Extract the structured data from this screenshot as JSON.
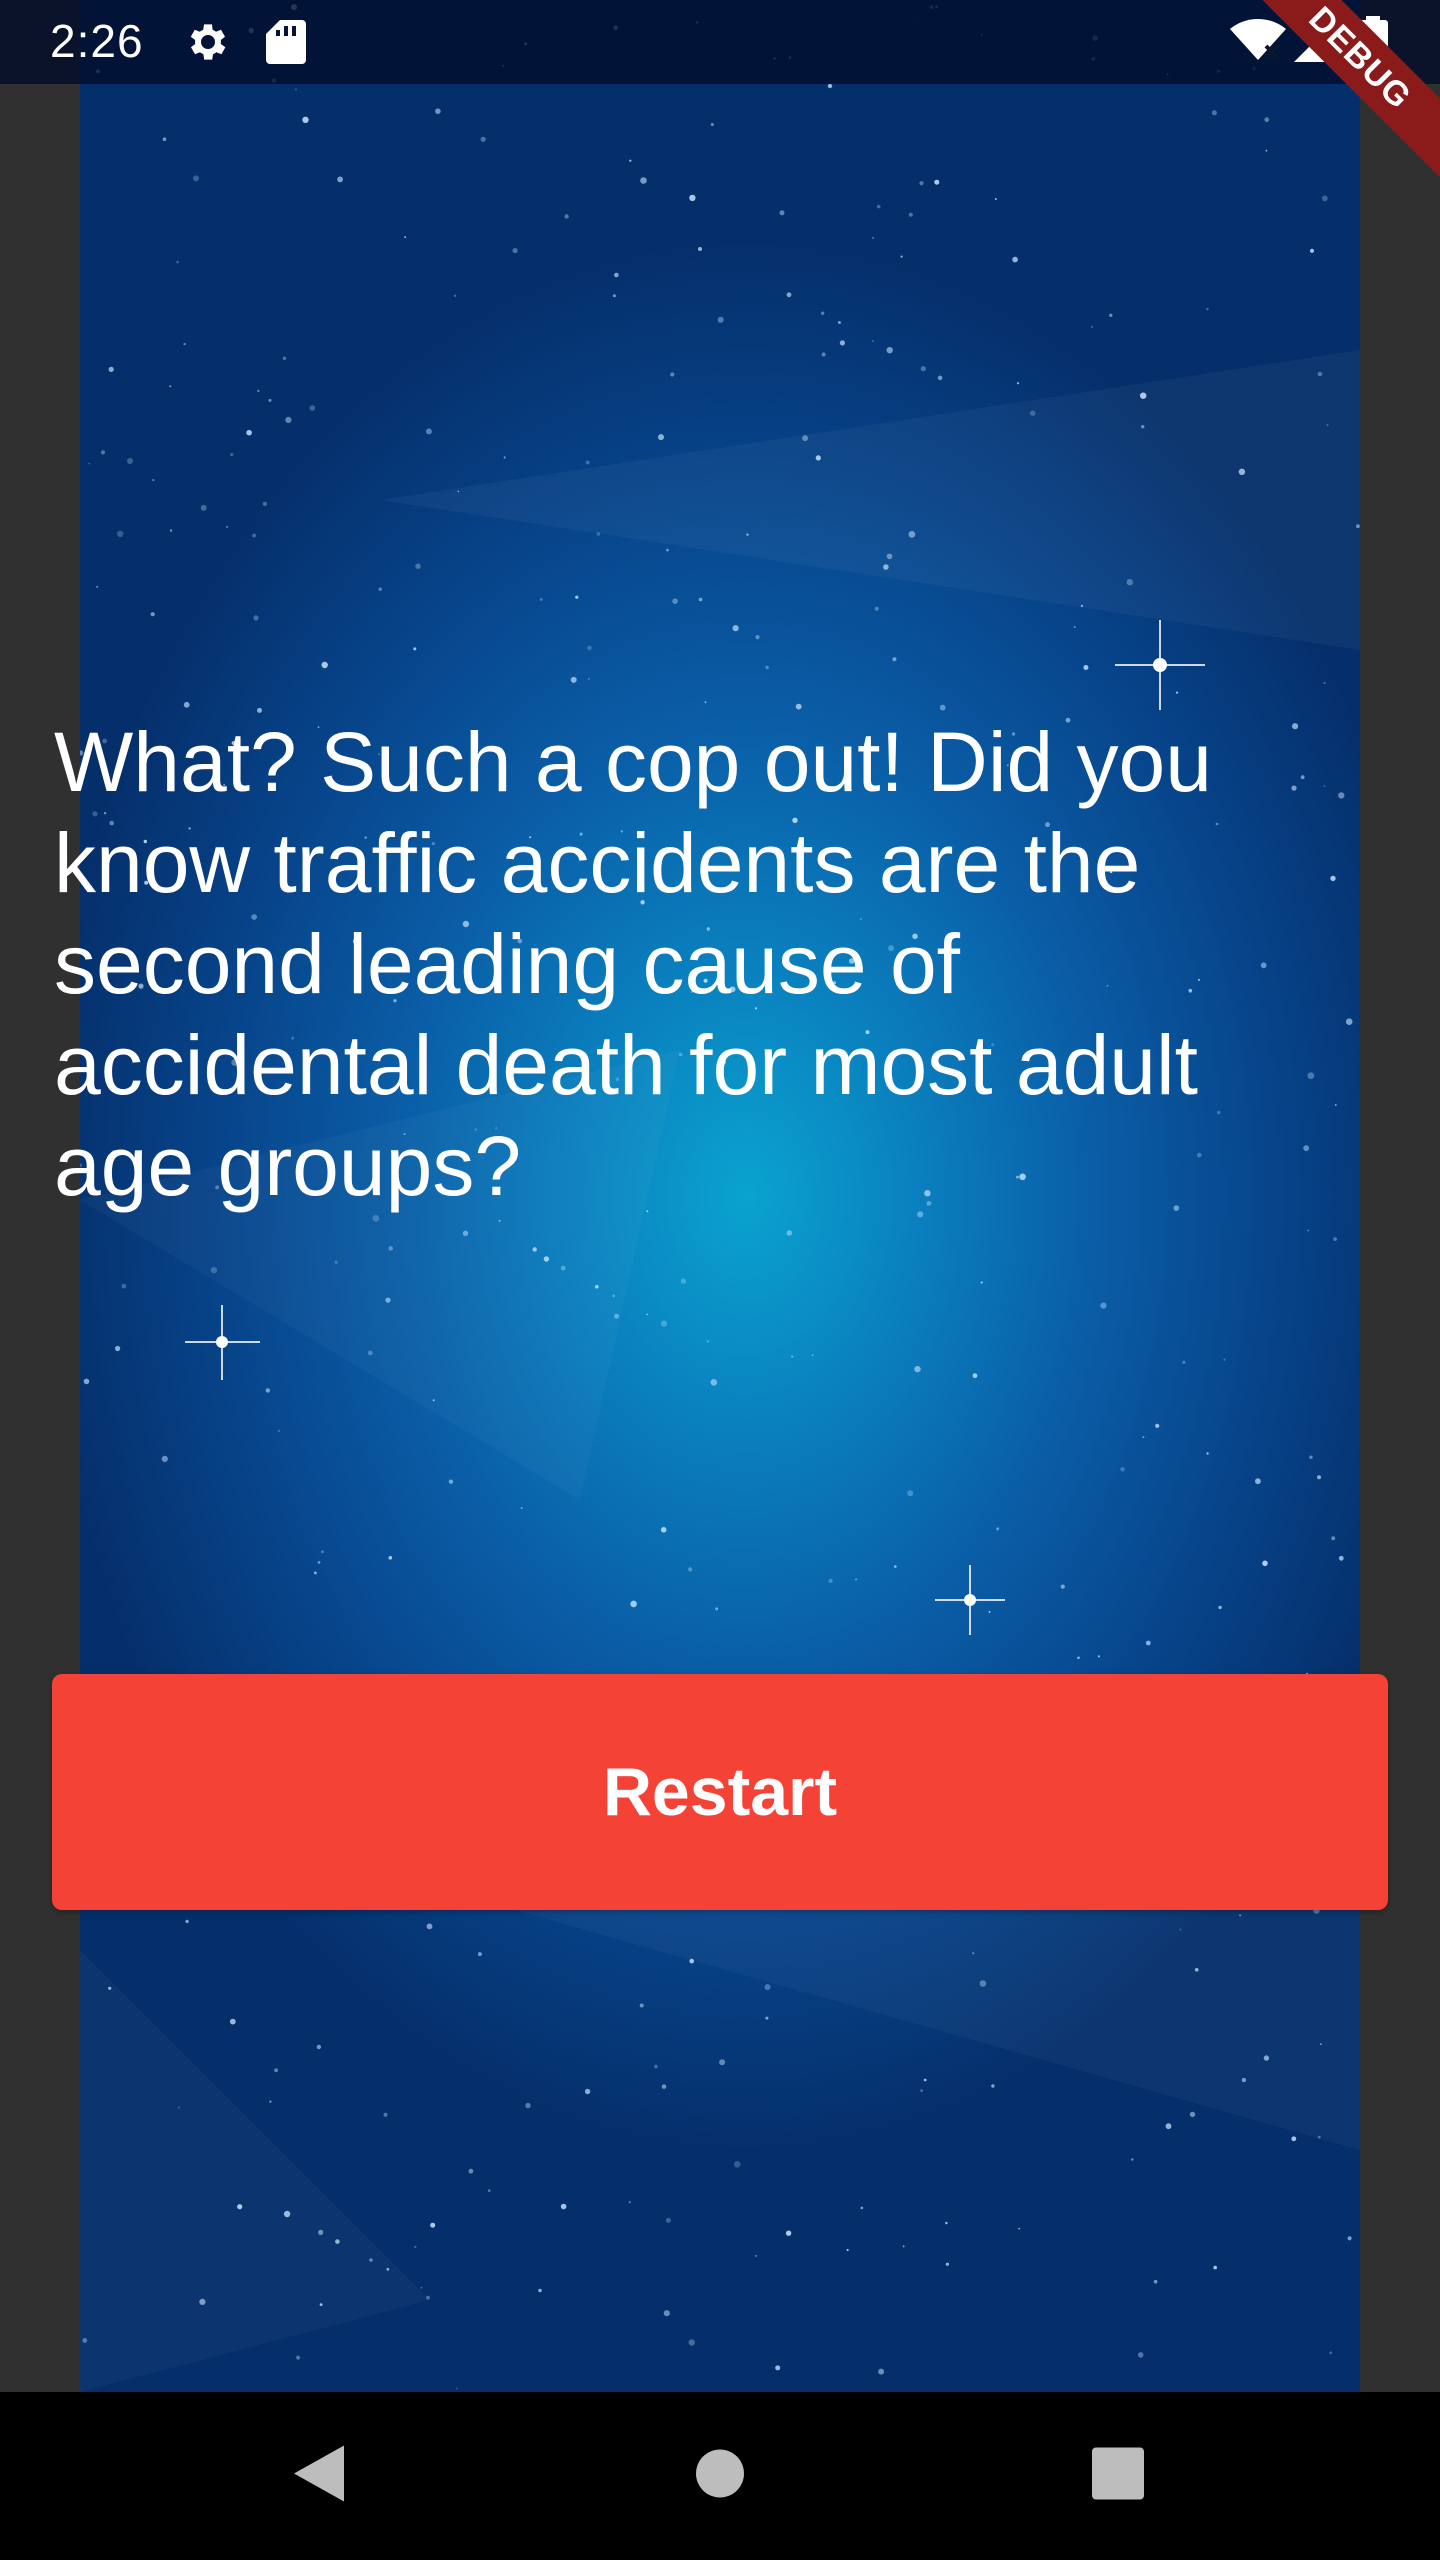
{
  "status_bar": {
    "time": "2:26",
    "icons": [
      "gear-icon",
      "sd-card-icon",
      "wifi-off-icon",
      "signal-icon",
      "battery-icon"
    ]
  },
  "debug_banner": {
    "label": "DEBUG"
  },
  "main": {
    "message": "What? Such a cop out! Did you know traffic accidents are the second leading cause of accidental death for most adult age groups?",
    "restart_label": "Restart"
  },
  "nav_bar": {
    "buttons": [
      "back-icon",
      "home-icon",
      "recents-icon"
    ]
  },
  "colors": {
    "button": "#f44336",
    "background_dark": "#052f6b",
    "background_light": "#0aa3cf",
    "side_gutter": "#303030",
    "debug_banner": "#8b1a1a"
  }
}
